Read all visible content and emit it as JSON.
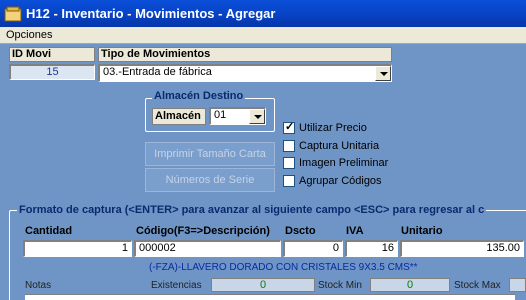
{
  "window": {
    "title": "H12 - Inventario - Movimientos - Agregar"
  },
  "menu": {
    "items": [
      "Opciones"
    ]
  },
  "id_movi": {
    "label": "ID Movi",
    "value": "15"
  },
  "tipo_movimientos": {
    "label": "Tipo de Movimientos",
    "selected": "03.-Entrada de fábrica"
  },
  "almacen_destino": {
    "group_label": "Almacén Destino",
    "label": "Almacén",
    "selected": "01"
  },
  "buttons": {
    "imprimir": "Imprimir Tamaño Carta",
    "numeros_serie": "Números de Serie"
  },
  "checkboxes": [
    {
      "label": "Utilizar Precio",
      "checked": true
    },
    {
      "label": "Captura Unitaria",
      "checked": false
    },
    {
      "label": "Imagen Preliminar",
      "checked": false
    },
    {
      "label": "Agrupar Códigos",
      "checked": false
    }
  ],
  "capture": {
    "title": "Formato de captura (<ENTER> para avanzar al siguiente campo <ESC> para regresar al c",
    "headers": {
      "cantidad": "Cantidad",
      "codigo": "Código(F3=>Descripción)",
      "dscto": "Dscto",
      "iva": "IVA",
      "unitario": "Unitario"
    },
    "values": {
      "cantidad": "1",
      "codigo": "000002",
      "dscto": "0",
      "iva": "16",
      "unitario": "135.00"
    },
    "description": "(-FZA)-LLAVERO DORADO CON CRISTALES 9X3.5 CMS**",
    "notas_label": "Notas",
    "existencias_label": "Existencias",
    "existencias_value": "0",
    "stock_min_label": "Stock Min",
    "stock_min_value": "0",
    "stock_max_label": "Stock Max"
  },
  "colors": {
    "titlebar": "#0842c4",
    "client_bg": "#6e95c6",
    "group_text": "#0a2a6e",
    "existencias_text": "#0a7a0a"
  }
}
